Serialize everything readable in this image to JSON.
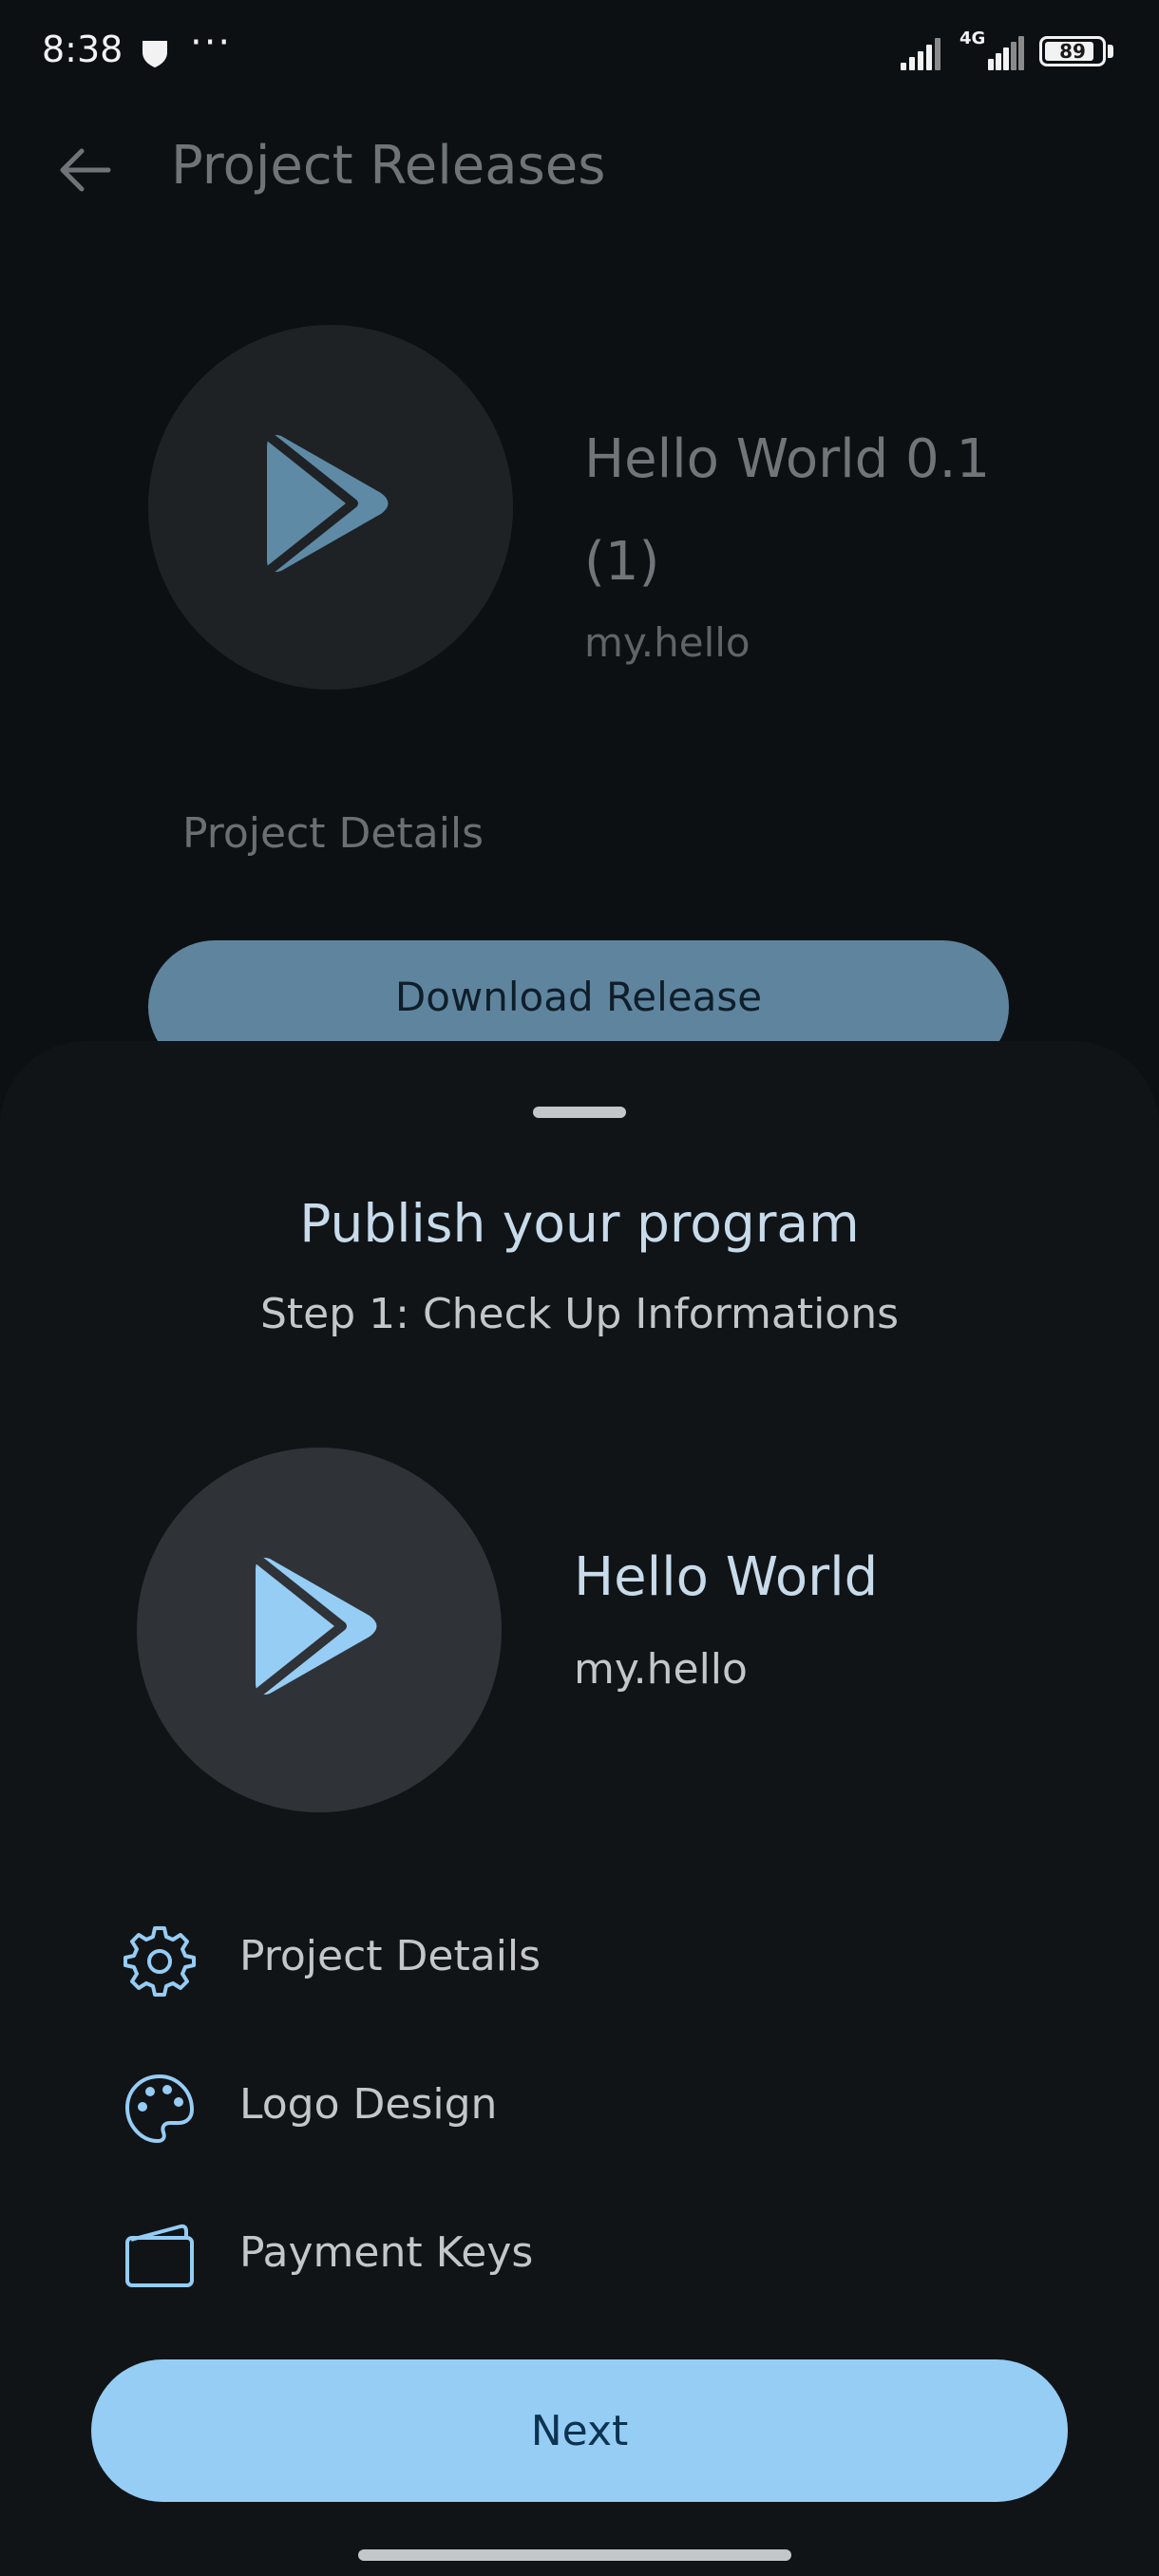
{
  "status_bar": {
    "time": "8:38",
    "more_indicator": "···",
    "network_type": "4G",
    "battery_level": "89",
    "battery_fraction": 0.89
  },
  "header": {
    "title": "Project Releases",
    "back_icon": "arrow-left-icon"
  },
  "release": {
    "title": "Hello World 0.1 (1)",
    "package": "my.hello",
    "project_details_label": "Project Details",
    "download_label": "Download Release",
    "logo_icon": "play-triangle-icon"
  },
  "sheet": {
    "title": "Publish your program",
    "subtitle": "Step 1: Check Up Informations",
    "app": {
      "name": "Hello World",
      "package": "my.hello",
      "logo_icon": "play-triangle-icon"
    },
    "items": [
      {
        "label": "Project Details",
        "icon": "gear-icon"
      },
      {
        "label": "Logo Design",
        "icon": "palette-icon"
      },
      {
        "label": "Payment Keys",
        "icon": "wallet-icon"
      }
    ],
    "next_label": "Next"
  },
  "colors": {
    "accent": "#95cdf5",
    "accent_dimmed": "#5f859e",
    "sheet_background": "#111417",
    "screen_background": "#0d1013"
  }
}
